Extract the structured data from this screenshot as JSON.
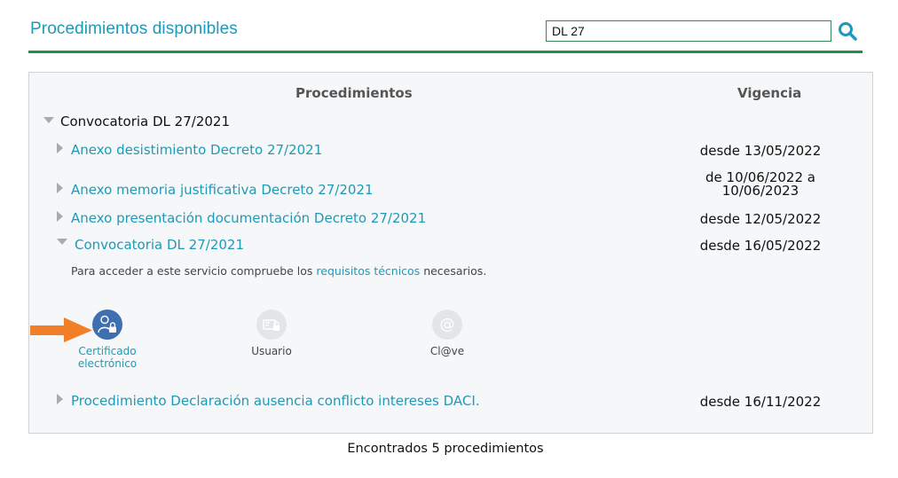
{
  "page": {
    "title": "Procedimientos disponibles"
  },
  "search": {
    "value": "DL 27"
  },
  "table": {
    "col_procedures": "Procedimientos",
    "col_validity": "Vigencia",
    "group": "Convocatoria DL 27/2021",
    "rows": [
      {
        "label": "Anexo desistimiento Decreto 27/2021",
        "date": "desde 13/05/2022"
      },
      {
        "label": "Anexo memoria justificativa Decreto 27/2021",
        "date_line1": "de 10/06/2022 a",
        "date_line2": "10/06/2023"
      },
      {
        "label": "Anexo presentación documentación Decreto 27/2021",
        "date": "desde 12/05/2022"
      },
      {
        "label": "Convocatoria DL 27/2021",
        "date": "desde 16/05/2022"
      },
      {
        "label": "Procedimiento Declaración ausencia conflicto intereses DACI.",
        "date": "desde 16/11/2022"
      }
    ]
  },
  "access_note": {
    "prefix": "Para acceder a este servicio compruebe los ",
    "link": "requisitos técnicos",
    "suffix": " necesarios."
  },
  "auth_methods": [
    {
      "line1": "Certificado",
      "line2": "electrónico",
      "icon": "certificate-user-lock-icon"
    },
    {
      "label": "Usuario",
      "icon": "user-id-card-icon"
    },
    {
      "label": "Cl@ve",
      "icon": "at-sign-icon"
    }
  ],
  "footer": {
    "count_text": "Encontrados 5 procedimientos"
  },
  "colors": {
    "accent": "#1e9ab8",
    "divider": "#1f8f4a",
    "auth_active": "#3f6fb0",
    "arrow": "#f07f27"
  }
}
